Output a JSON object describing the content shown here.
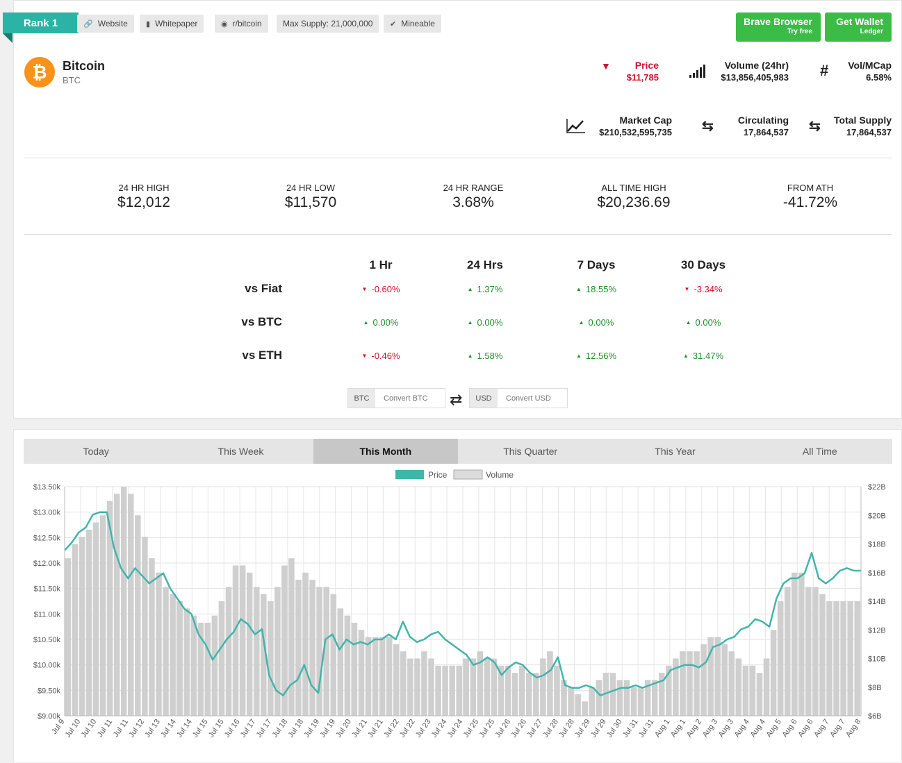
{
  "rank": "Rank 1",
  "tags": [
    {
      "icon": "link-icon",
      "label": "Website"
    },
    {
      "icon": "document-icon",
      "label": "Whitepaper"
    },
    {
      "icon": "reddit-icon",
      "label": "r/bitcoin"
    },
    {
      "icon": "",
      "label": "Max Supply: 21,000,000"
    },
    {
      "icon": "check-icon",
      "label": "Mineable"
    }
  ],
  "promos": [
    {
      "title": "Brave Browser",
      "sub": "Try free"
    },
    {
      "title": "Get Wallet",
      "sub": "Ledger"
    }
  ],
  "coin": {
    "name": "Bitcoin",
    "symbol": "BTC",
    "logo_color": "#f7931a"
  },
  "stats": {
    "price": {
      "label": "Price",
      "value": "$11,785",
      "direction": "down",
      "color": "#d0102e"
    },
    "volume": {
      "label": "Volume (24hr)",
      "value": "$13,856,405,983"
    },
    "vol_mcap": {
      "label": "Vol/MCap",
      "value": "6.58%"
    },
    "market_cap": {
      "label": "Market Cap",
      "value": "$210,532,595,735"
    },
    "circulating": {
      "label": "Circulating",
      "value": "17,864,537"
    },
    "total_supply": {
      "label": "Total Supply",
      "value": "17,864,537"
    }
  },
  "kpis": [
    {
      "label": "24 HR HIGH",
      "value": "$12,012"
    },
    {
      "label": "24 HR LOW",
      "value": "$11,570"
    },
    {
      "label": "24 HR RANGE",
      "value": "3.68%"
    },
    {
      "label": "ALL TIME HIGH",
      "value": "$20,236.69"
    },
    {
      "label": "FROM ATH",
      "value": "-41.72%"
    }
  ],
  "performance": {
    "columns": [
      "1 Hr",
      "24 Hrs",
      "7 Days",
      "30 Days"
    ],
    "rows": [
      {
        "label": "vs Fiat",
        "values": [
          {
            "v": "-0.60%",
            "d": "down"
          },
          {
            "v": "1.37%",
            "d": "up"
          },
          {
            "v": "18.55%",
            "d": "up"
          },
          {
            "v": "-3.34%",
            "d": "down"
          }
        ]
      },
      {
        "label": "vs BTC",
        "values": [
          {
            "v": "0.00%",
            "d": "up"
          },
          {
            "v": "0.00%",
            "d": "up"
          },
          {
            "v": "0.00%",
            "d": "up"
          },
          {
            "v": "0.00%",
            "d": "up"
          }
        ]
      },
      {
        "label": "vs ETH",
        "values": [
          {
            "v": "-0.46%",
            "d": "down"
          },
          {
            "v": "1.58%",
            "d": "up"
          },
          {
            "v": "12.56%",
            "d": "up"
          },
          {
            "v": "31.47%",
            "d": "up"
          }
        ]
      }
    ]
  },
  "converter": {
    "from": {
      "currency": "BTC",
      "placeholder": "Convert BTC"
    },
    "to": {
      "currency": "USD",
      "placeholder": "Convert USD"
    }
  },
  "tabs": [
    "Today",
    "This Week",
    "This Month",
    "This Quarter",
    "This Year",
    "All Time"
  ],
  "active_tab": "This Month",
  "chart_data": {
    "type": "line",
    "legend": [
      {
        "name": "Price",
        "color": "#42b5a9"
      },
      {
        "name": "Volume",
        "color": "#cccccc"
      }
    ],
    "legend_position": "top-center",
    "grid": true,
    "y_left": {
      "ticks": [
        "$9.00k",
        "$9.50k",
        "$10.00k",
        "$10.50k",
        "$11.00k",
        "$11.50k",
        "$12.00k",
        "$12.50k",
        "$13.00k",
        "$13.50k"
      ],
      "range": [
        9000,
        13500
      ]
    },
    "y_right": {
      "ticks": [
        "$6B",
        "$8B",
        "$10B",
        "$12B",
        "$14B",
        "$16B",
        "$18B",
        "$20B",
        "$22B"
      ],
      "range": [
        6,
        22
      ]
    },
    "x_ticks": [
      "Jul 9",
      "Jul 10",
      "Jul 10",
      "Jul 11",
      "Jul 11",
      "Jul 12",
      "Jul 13",
      "Jul 14",
      "Jul 14",
      "Jul 15",
      "Jul 15",
      "Jul 16",
      "Jul 17",
      "Jul 17",
      "Jul 18",
      "Jul 18",
      "Jul 19",
      "Jul 19",
      "Jul 20",
      "Jul 21",
      "Jul 21",
      "Jul 22",
      "Jul 22",
      "Jul 23",
      "Jul 24",
      "Jul 24",
      "Jul 25",
      "Jul 25",
      "Jul 26",
      "Jul 26",
      "Jul 27",
      "Jul 28",
      "Jul 28",
      "Jul 29",
      "Jul 29",
      "Jul 30",
      "Jul 31",
      "Jul 31",
      "Aug 1",
      "Aug 1",
      "Aug 2",
      "Aug 3",
      "Aug 3",
      "Aug 4",
      "Aug 4",
      "Aug 5",
      "Aug 6",
      "Aug 6",
      "Aug 7",
      "Aug 7",
      "Aug 8"
    ],
    "series": [
      {
        "name": "Price",
        "axis": "left",
        "values": [
          12250,
          12400,
          12600,
          12700,
          12950,
          13000,
          13000,
          12300,
          11900,
          11700,
          11900,
          11750,
          11600,
          11700,
          11800,
          11500,
          11300,
          11100,
          11000,
          10600,
          10400,
          10100,
          10300,
          10500,
          10650,
          10900,
          10800,
          10600,
          10700,
          9800,
          9500,
          9400,
          9600,
          9700,
          10000,
          9600,
          9450,
          10500,
          10600,
          10300,
          10500,
          10400,
          10450,
          10400,
          10500,
          10500,
          10600,
          10500,
          10850,
          10550,
          10450,
          10500,
          10600,
          10650,
          10500,
          10400,
          10300,
          10200,
          10000,
          10050,
          10150,
          10050,
          9800,
          9950,
          10050,
          10000,
          9850,
          9750,
          9800,
          9900,
          10150,
          9600,
          9550,
          9550,
          9600,
          9550,
          9400,
          9450,
          9500,
          9550,
          9550,
          9600,
          9550,
          9600,
          9650,
          9700,
          9900,
          9950,
          10000,
          10000,
          9950,
          10050,
          10350,
          10400,
          10500,
          10550,
          10700,
          10750,
          10900,
          10850,
          10750,
          11300,
          11600,
          11700,
          11700,
          11800,
          12200,
          11700,
          11600,
          11700,
          11850,
          11900,
          11850,
          11850
        ]
      },
      {
        "name": "Volume",
        "axis": "right",
        "values": [
          17,
          18,
          18.5,
          19,
          19.5,
          20,
          21,
          21.5,
          22,
          21.5,
          20,
          18.5,
          17,
          16,
          15,
          14.5,
          14,
          13.5,
          13,
          12.5,
          12.5,
          13,
          14,
          15,
          16.5,
          16.5,
          16,
          15,
          14.5,
          14,
          15,
          16.5,
          17,
          15.5,
          16,
          15.5,
          15,
          15,
          14.5,
          13.5,
          13,
          12.5,
          12,
          11.5,
          11.5,
          11.5,
          11.5,
          11,
          10.5,
          10,
          10,
          10.5,
          10,
          9.5,
          9.5,
          9.5,
          9.5,
          10,
          10,
          10.5,
          10,
          10,
          9.5,
          9.5,
          9,
          9.5,
          9,
          9,
          10,
          10.5,
          9.5,
          8.5,
          8,
          7.5,
          7,
          8,
          8.5,
          9,
          9,
          8.5,
          8.5,
          8,
          8,
          8.5,
          8.5,
          9,
          9.5,
          10,
          10.5,
          10.5,
          10.5,
          11,
          11.5,
          11.5,
          11,
          10.5,
          10,
          9.5,
          9.5,
          9,
          10,
          12,
          14,
          15,
          16,
          16,
          15,
          15,
          14.5,
          14,
          14,
          14,
          14,
          14
        ]
      }
    ]
  }
}
